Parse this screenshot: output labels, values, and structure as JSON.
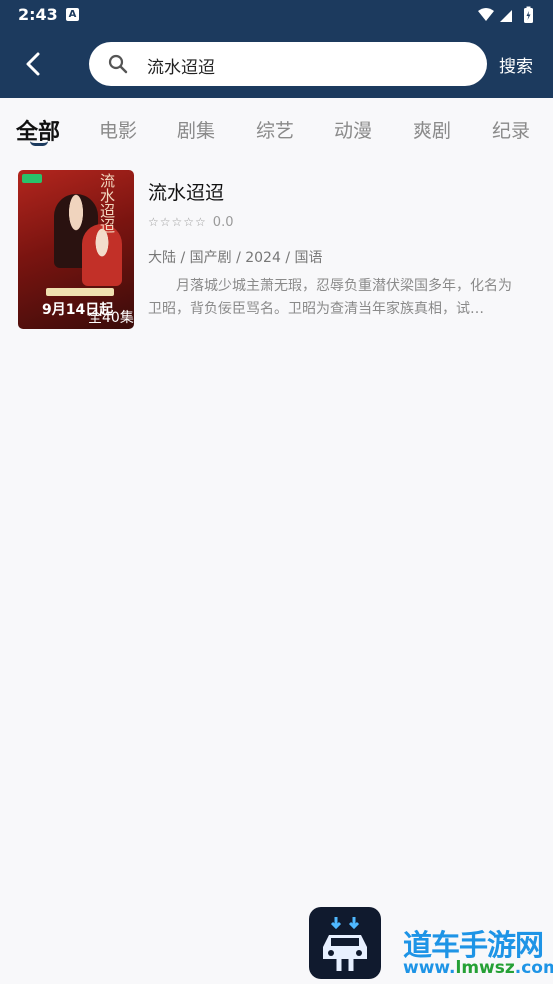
{
  "status_bar": {
    "time": "2:43",
    "notification_letter": "A"
  },
  "header": {
    "back_icon": "chevron-left-icon",
    "search_query": "流水迢迢",
    "search_icon": "search-icon",
    "search_button_label": "搜索"
  },
  "tabs": [
    {
      "label": "全部",
      "active": true
    },
    {
      "label": "电影",
      "active": false
    },
    {
      "label": "剧集",
      "active": false
    },
    {
      "label": "综艺",
      "active": false
    },
    {
      "label": "动漫",
      "active": false
    },
    {
      "label": "爽剧",
      "active": false
    },
    {
      "label": "纪录",
      "active": false
    }
  ],
  "results": [
    {
      "title": "流水迢迢",
      "stars": "☆☆☆☆☆",
      "score": "0.0",
      "meta": "大陆 / 国产剧 / 2024 / 国语",
      "description": "月落城少城主萧无瑕，忍辱负重潜伏梁国多年，化名为卫昭，背负佞臣骂名。卫昭为查清当年家族真相，试…",
      "poster": {
        "title_text": "流水迢迢",
        "date_text": "9月14日起",
        "episodes_text": "全40集"
      }
    }
  ],
  "watermark": {
    "text": "道车手游网",
    "url_prefix": "www.",
    "url_main": "lmwsz",
    "url_suffix": ".com"
  },
  "colors": {
    "header_bg": "#1c3a5e",
    "active_tab": "#111111",
    "inactive_tab": "#8a8a8a",
    "watermark_blue": "#1e94e6"
  }
}
